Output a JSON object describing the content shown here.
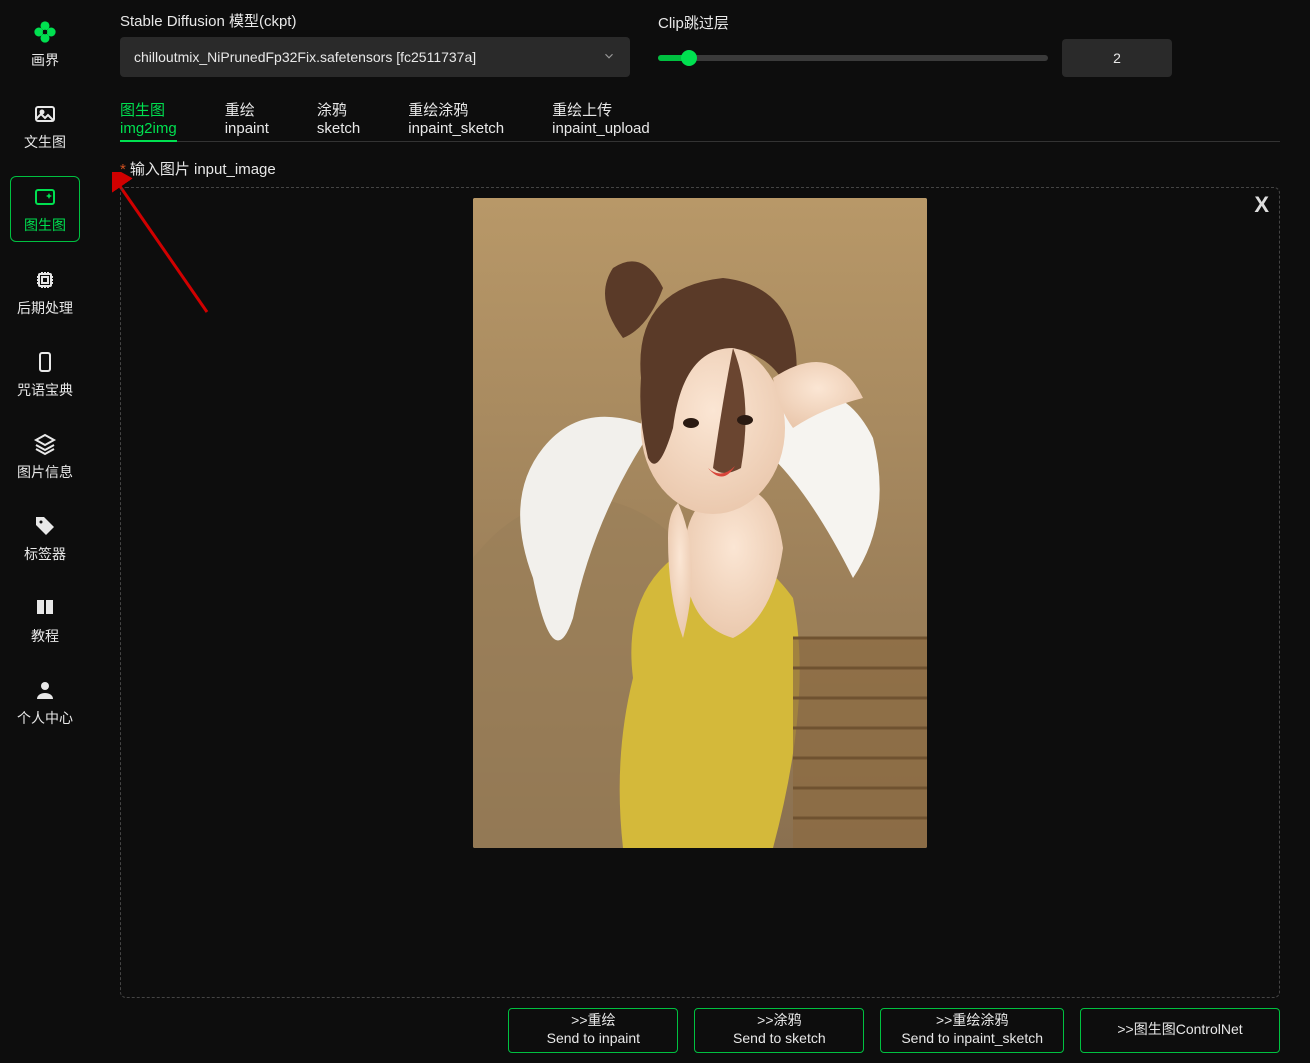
{
  "brand": "画界",
  "sidebar": {
    "items": [
      {
        "label": "文生图"
      },
      {
        "label": "图生图"
      },
      {
        "label": "后期处理"
      },
      {
        "label": "咒语宝典"
      },
      {
        "label": "图片信息"
      },
      {
        "label": "标签器"
      },
      {
        "label": "教程"
      },
      {
        "label": "个人中心"
      }
    ]
  },
  "model": {
    "label": "Stable Diffusion 模型(ckpt)",
    "value": "chilloutmix_NiPrunedFp32Fix.safetensors [fc2511737a]"
  },
  "clip": {
    "label": "Clip跳过层",
    "value": "2"
  },
  "tabs": [
    {
      "cn": "图生图",
      "en": "img2img"
    },
    {
      "cn": "重绘",
      "en": "inpaint"
    },
    {
      "cn": "涂鸦",
      "en": "sketch"
    },
    {
      "cn": "重绘涂鸦",
      "en": "inpaint_sketch"
    },
    {
      "cn": "重绘上传",
      "en": "inpaint_upload"
    }
  ],
  "input_image": {
    "star": "*",
    "label": "输入图片 input_image",
    "close": "X"
  },
  "buttons": [
    {
      "cn": ">>重绘",
      "en": "Send to inpaint"
    },
    {
      "cn": ">>涂鸦",
      "en": "Send to sketch"
    },
    {
      "cn": ">>重绘涂鸦",
      "en": "Send to inpaint_sketch"
    },
    {
      "cn": ">>图生图ControlNet",
      "en": ""
    }
  ]
}
